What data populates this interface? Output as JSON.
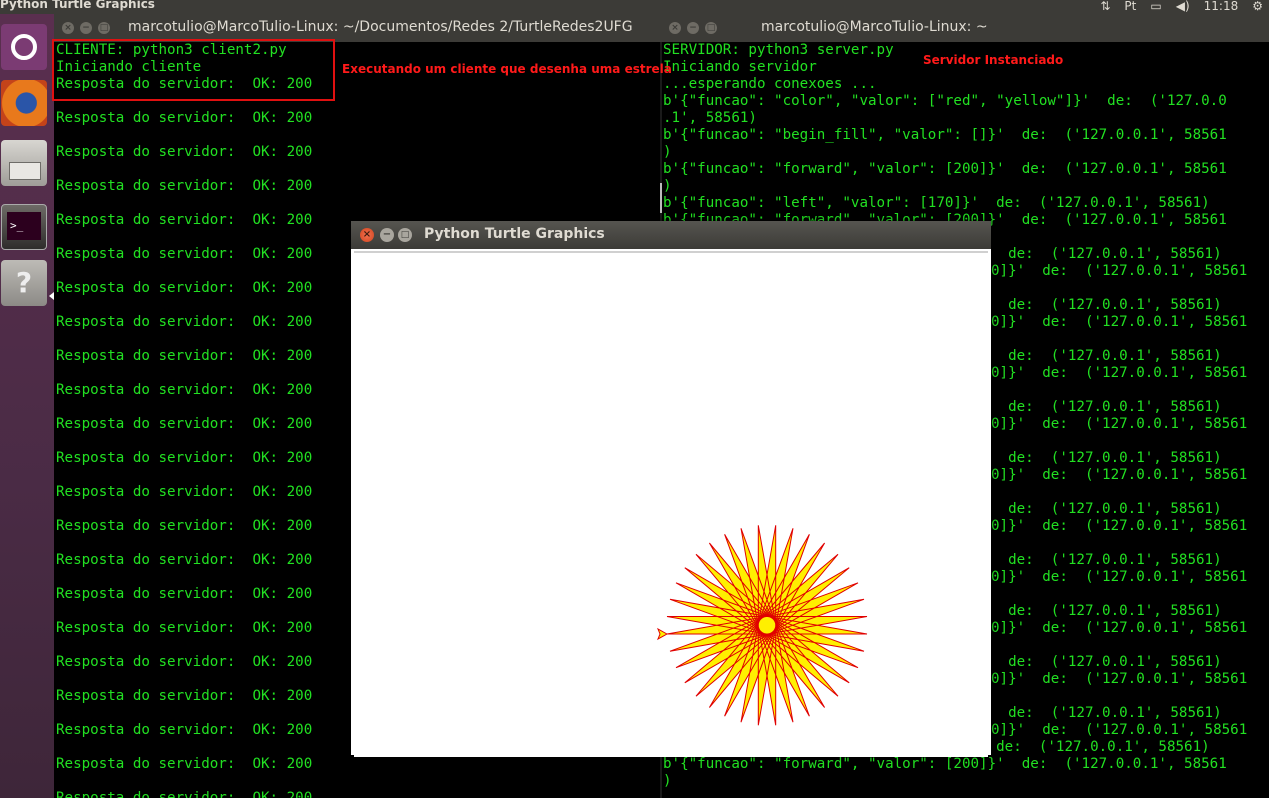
{
  "top_panel": {
    "title": "Python Turtle Graphics",
    "clock": "11:18"
  },
  "launcher": {
    "items": [
      "ubuntu-dash-icon",
      "firefox-icon",
      "files-icon",
      "terminal-icon",
      "help-icon"
    ]
  },
  "client_terminal": {
    "title": "marcotulio@MarcoTulio-Linux: ~/Documentos/Redes 2/TurtleRedes2UFG",
    "header_lines": [
      "CLIENTE: python3 client2.py",
      "Iniciando cliente",
      "Resposta do servidor:  OK: 200"
    ],
    "response_text": "Resposta do servidor:  OK: 200"
  },
  "server_terminal": {
    "title": "marcotulio@MarcoTulio-Linux: ~",
    "lines": [
      "SERVIDOR: python3 server.py",
      "Iniciando servidor",
      "...esperando conexoes ...",
      "b'{\"funcao\": \"color\", \"valor\": [\"red\", \"yellow\"]}'  de:  ('127.0.0",
      ".1', 58561)",
      "b'{\"funcao\": \"begin_fill\", \"valor\": []}'  de:  ('127.0.0.1', 58561",
      ")",
      "b'{\"funcao\": \"forward\", \"valor\": [200]}'  de:  ('127.0.0.1', 58561",
      ")",
      "b'{\"funcao\": \"left\", \"valor\": [170]}'  de:  ('127.0.0.1', 58561)",
      "b'{\"funcao\": \"forward\", \"valor\": [200]}'  de:  ('127.0.0.1', 58561"
    ],
    "repeat_a": "  de:  ('127.0.0.1', 58561)",
    "repeat_b": "0]}'  de:  ('127.0.0.1', 58561",
    "bottom_lines": [
      "b'{\"funcao\": \"left\", \"valor\": [170]}'  de:  ('127.0.0.1', 58561)",
      "b'{\"funcao\": \"forward\", \"valor\": [200]}'  de:  ('127.0.0.1', 58561",
      ")"
    ]
  },
  "annotations": {
    "client": "Executando um cliente que desenha uma estrela",
    "server": "Servidor Instanciado"
  },
  "turtle_window": {
    "title": "Python Turtle Graphics",
    "star": {
      "points": 36,
      "step": 200,
      "angle": 170,
      "pen_color": "#e00000",
      "fill_color": "#ffef00"
    }
  },
  "colors": {
    "terminal_text": "#22e022",
    "annotation": "#ff1a1a",
    "launcher": "#4a2b45"
  }
}
